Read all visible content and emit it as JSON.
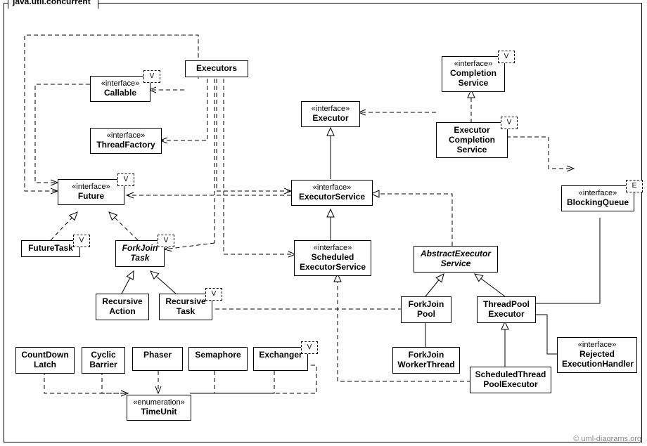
{
  "package": {
    "name": "java.util.concurrent"
  },
  "nodes": {
    "Executors": {
      "stereo": "",
      "name": "Executors"
    },
    "Callable": {
      "stereo": "«interface»",
      "name": "Callable"
    },
    "ThreadFactory": {
      "stereo": "«interface»",
      "name": "ThreadFactory"
    },
    "Future": {
      "stereo": "«interface»",
      "name": "Future"
    },
    "FutureTask": {
      "stereo": "",
      "name": "FutureTask"
    },
    "ForkJoinTask": {
      "stereo": "",
      "name": "ForkJoin\nTask"
    },
    "RecursiveAction": {
      "stereo": "",
      "name": "Recursive\nAction"
    },
    "RecursiveTask": {
      "stereo": "",
      "name": "Recursive\nTask"
    },
    "Executor": {
      "stereo": "«interface»",
      "name": "Executor"
    },
    "ExecutorService": {
      "stereo": "«interface»",
      "name": "ExecutorService"
    },
    "ScheduledExecutorService": {
      "stereo": "«interface»",
      "name": "Scheduled\nExecutorService"
    },
    "AbstractExecutorService": {
      "stereo": "",
      "name": "AbstractExecutor\nService"
    },
    "ForkJoinPool": {
      "stereo": "",
      "name": "ForkJoin\nPool"
    },
    "ThreadPoolExecutor": {
      "stereo": "",
      "name": "ThreadPool\nExecutor"
    },
    "ForkJoinWorkerThread": {
      "stereo": "",
      "name": "ForkJoin\nWorkerThread"
    },
    "ScheduledThreadPoolExecutor": {
      "stereo": "",
      "name": "ScheduledThread\nPoolExecutor"
    },
    "CompletionService": {
      "stereo": "«interface»",
      "name": "Completion\nService"
    },
    "ExecutorCompletionService": {
      "stereo": "",
      "name": "Executor\nCompletion\nService"
    },
    "BlockingQueue": {
      "stereo": "«interface»",
      "name": "BlockingQueue"
    },
    "RejectedExecutionHandler": {
      "stereo": "«interface»",
      "name": "Rejected\nExecutionHandler"
    },
    "CountDownLatch": {
      "stereo": "",
      "name": "CountDown\nLatch"
    },
    "CyclicBarrier": {
      "stereo": "",
      "name": "Cyclic\nBarrier"
    },
    "Phaser": {
      "stereo": "",
      "name": "Phaser"
    },
    "Semaphore": {
      "stereo": "",
      "name": "Semaphore"
    },
    "Exchanger": {
      "stereo": "",
      "name": "Exchanger"
    },
    "TimeUnit": {
      "stereo": "«enumeration»",
      "name": "TimeUnit"
    }
  },
  "flags": {
    "Callable": "V",
    "Future": "V",
    "FutureTask": "V",
    "ForkJoinTask": "V",
    "RecursiveTask": "V",
    "Exchanger": "V",
    "CompletionService": "V",
    "ExecutorCompletionService": "V",
    "BlockingQueue": "E"
  },
  "credit": "© uml-diagrams.org",
  "chart_data": {
    "type": "uml-class-diagram",
    "package": "java.util.concurrent",
    "classes": [
      {
        "name": "Executors",
        "kind": "class"
      },
      {
        "name": "Callable",
        "kind": "interface",
        "typeParam": "V"
      },
      {
        "name": "ThreadFactory",
        "kind": "interface"
      },
      {
        "name": "Future",
        "kind": "interface",
        "typeParam": "V"
      },
      {
        "name": "FutureTask",
        "kind": "class",
        "typeParam": "V"
      },
      {
        "name": "ForkJoinTask",
        "kind": "abstract",
        "typeParam": "V"
      },
      {
        "name": "RecursiveAction",
        "kind": "class"
      },
      {
        "name": "RecursiveTask",
        "kind": "class",
        "typeParam": "V"
      },
      {
        "name": "Executor",
        "kind": "interface"
      },
      {
        "name": "ExecutorService",
        "kind": "interface"
      },
      {
        "name": "ScheduledExecutorService",
        "kind": "interface"
      },
      {
        "name": "AbstractExecutorService",
        "kind": "abstract"
      },
      {
        "name": "ForkJoinPool",
        "kind": "class"
      },
      {
        "name": "ThreadPoolExecutor",
        "kind": "class"
      },
      {
        "name": "ForkJoinWorkerThread",
        "kind": "class"
      },
      {
        "name": "ScheduledThreadPoolExecutor",
        "kind": "class"
      },
      {
        "name": "CompletionService",
        "kind": "interface",
        "typeParam": "V"
      },
      {
        "name": "ExecutorCompletionService",
        "kind": "class",
        "typeParam": "V"
      },
      {
        "name": "BlockingQueue",
        "kind": "interface",
        "typeParam": "E"
      },
      {
        "name": "RejectedExecutionHandler",
        "kind": "interface"
      },
      {
        "name": "CountDownLatch",
        "kind": "class"
      },
      {
        "name": "CyclicBarrier",
        "kind": "class"
      },
      {
        "name": "Phaser",
        "kind": "class"
      },
      {
        "name": "Semaphore",
        "kind": "class"
      },
      {
        "name": "Exchanger",
        "kind": "class",
        "typeParam": "V"
      },
      {
        "name": "TimeUnit",
        "kind": "enumeration"
      }
    ],
    "relations": [
      {
        "from": "ExecutorService",
        "to": "Executor",
        "type": "generalization"
      },
      {
        "from": "ScheduledExecutorService",
        "to": "ExecutorService",
        "type": "generalization"
      },
      {
        "from": "AbstractExecutorService",
        "to": "ExecutorService",
        "type": "realization"
      },
      {
        "from": "ForkJoinPool",
        "to": "AbstractExecutorService",
        "type": "generalization"
      },
      {
        "from": "ThreadPoolExecutor",
        "to": "AbstractExecutorService",
        "type": "generalization"
      },
      {
        "from": "ScheduledThreadPoolExecutor",
        "to": "ThreadPoolExecutor",
        "type": "generalization"
      },
      {
        "from": "ScheduledThreadPoolExecutor",
        "to": "ScheduledExecutorService",
        "type": "realization"
      },
      {
        "from": "FutureTask",
        "to": "Future",
        "type": "realization"
      },
      {
        "from": "ForkJoinTask",
        "to": "Future",
        "type": "realization"
      },
      {
        "from": "RecursiveAction",
        "to": "ForkJoinTask",
        "type": "generalization"
      },
      {
        "from": "RecursiveTask",
        "to": "ForkJoinTask",
        "type": "generalization"
      },
      {
        "from": "ExecutorCompletionService",
        "to": "CompletionService",
        "type": "realization"
      },
      {
        "from": "ForkJoinPool",
        "to": "ForkJoinWorkerThread",
        "type": "aggregation"
      },
      {
        "from": "ThreadPoolExecutor",
        "to": "BlockingQueue",
        "type": "aggregation"
      },
      {
        "from": "ThreadPoolExecutor",
        "to": "RejectedExecutionHandler",
        "type": "aggregation"
      },
      {
        "from": "Executors",
        "to": "Callable",
        "type": "dependency"
      },
      {
        "from": "Executors",
        "to": "ThreadFactory",
        "type": "dependency"
      },
      {
        "from": "Executors",
        "to": "ExecutorService",
        "type": "dependency"
      },
      {
        "from": "Executors",
        "to": "ScheduledExecutorService",
        "type": "dependency"
      },
      {
        "from": "Executors",
        "to": "ForkJoinTask",
        "type": "dependency"
      },
      {
        "from": "ExecutorService",
        "to": "Future",
        "type": "dependency"
      },
      {
        "from": "ExecutorCompletionService",
        "to": "Executor",
        "type": "dependency"
      },
      {
        "from": "ExecutorCompletionService",
        "to": "BlockingQueue",
        "type": "dependency"
      },
      {
        "from": "ForkJoinPool",
        "to": "RecursiveTask",
        "type": "dependency"
      },
      {
        "from": "Callable",
        "to": "Future",
        "type": "dependency"
      },
      {
        "from": "CountDownLatch",
        "to": "TimeUnit",
        "type": "dependency"
      },
      {
        "from": "CyclicBarrier",
        "to": "TimeUnit",
        "type": "dependency"
      },
      {
        "from": "Phaser",
        "to": "TimeUnit",
        "type": "dependency"
      },
      {
        "from": "Semaphore",
        "to": "TimeUnit",
        "type": "dependency"
      },
      {
        "from": "Exchanger",
        "to": "TimeUnit",
        "type": "dependency"
      }
    ]
  }
}
